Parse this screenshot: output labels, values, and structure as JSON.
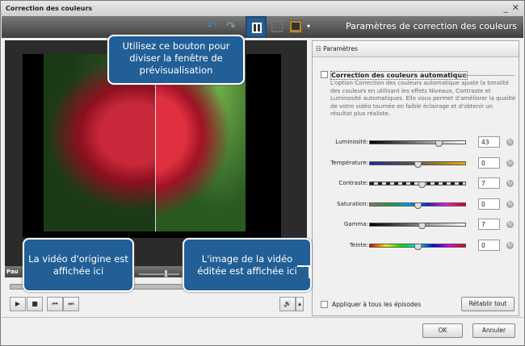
{
  "window": {
    "title": "Correction des couleurs",
    "close": "✕",
    "minimize": "_"
  },
  "toolbar": {
    "title": "Paramètres de correction des couleurs",
    "undo": "↶",
    "redo": "↷",
    "dropdown": "▾"
  },
  "player": {
    "status": "Pau",
    "play": "▶",
    "stop": "■",
    "prev": "⏮",
    "next": "⏭",
    "volume": "🔊",
    "vol_menu": "▴",
    "volume_level": 0.65
  },
  "panel": {
    "header": "Paramètres",
    "auto_label": "Correction des couleurs automatique",
    "auto_checked": false,
    "auto_desc": "L'option Correction des couleurs automatique ajuste la tonalité des couleurs en utilisant les effets Niveaux, Contraste et Luminosité automatiques. Elle vous permet d'améliorer la qualité de votre vidéo tournée en faible éclairage et d'obtenir un résultat plus réaliste.",
    "sliders": [
      {
        "label": "Luminosité:",
        "value": "43",
        "pos": 0.72
      },
      {
        "label": "Température:",
        "value": "0",
        "pos": 0.5
      },
      {
        "label": "Contraste:",
        "value": "7",
        "pos": 0.54
      },
      {
        "label": "Saturation:",
        "value": "0",
        "pos": 0.5
      },
      {
        "label": "Gamma:",
        "value": "7",
        "pos": 0.54
      },
      {
        "label": "Teinte:",
        "value": "0",
        "pos": 0.5
      }
    ],
    "apply_all": "Appliquer à tous les épisodes",
    "reset": "Rétablir tout"
  },
  "buttons": {
    "ok": "OK",
    "cancel": "Annuler"
  },
  "callouts": {
    "split": "Utilisez ce bouton pour diviser la fenêtre de prévisualisation",
    "original": "La vidéo d'origine est affichée ici",
    "edited": "L'image de la vidéo éditée est affichée ici"
  }
}
